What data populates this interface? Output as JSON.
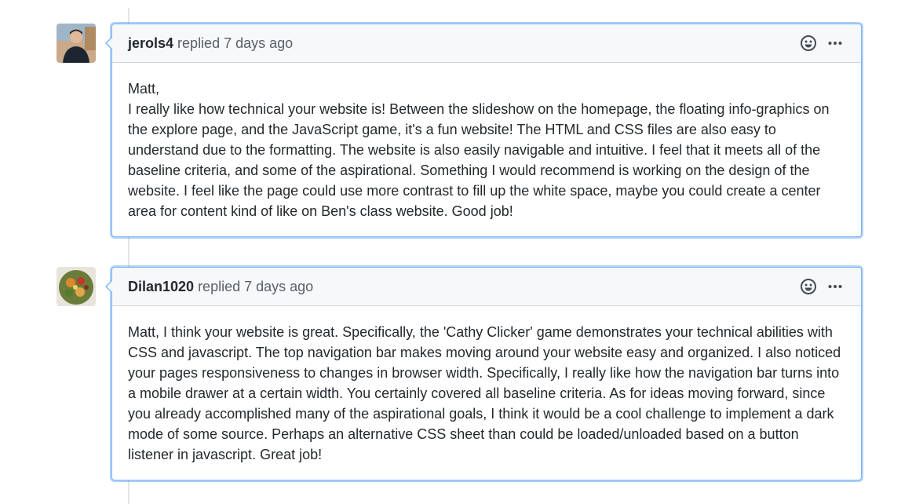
{
  "colors": {
    "accent_border": "#79b8ff",
    "header_bg": "#f6f8fa",
    "text": "#24292e",
    "muted": "#586069",
    "timeline": "#e1e4e8"
  },
  "comments": [
    {
      "author": "jerols4",
      "action": "replied",
      "timestamp": "7 days ago",
      "avatar_icon": "user-photo-avatar",
      "body": "Matt,\nI really like how technical your website is! Between the slideshow on the homepage, the floating info-graphics on the explore page, and the JavaScript game, it's a fun website! The HTML and CSS files are also easy to understand due to the formatting. The website is also easily navigable and intuitive. I feel that it meets all of the baseline criteria, and some of the aspirational. Something I would recommend is working on the design of the website. I feel like the page could use more contrast to fill up the white space, maybe you could create a center area for content kind of like on Ben's class website. Good job!"
    },
    {
      "author": "Dilan1020",
      "action": "replied",
      "timestamp": "7 days ago",
      "avatar_icon": "food-bowl-avatar",
      "body": "Matt, I think your website is great. Specifically, the 'Cathy Clicker' game demonstrates your technical abilities with CSS and javascript. The top navigation bar makes moving around your website easy and organized. I also noticed your pages responsiveness to changes in browser width. Specifically, I really like how the navigation bar turns into a mobile drawer at a certain width. You certainly covered all baseline criteria. As for ideas moving forward, since you already accomplished many of the aspirational goals, I think it would be a cool challenge to implement a dark mode of some source. Perhaps an alternative CSS sheet than could be loaded/unloaded based on a button listener in javascript. Great job!"
    }
  ],
  "icons": {
    "reaction": "smiley-icon",
    "more": "kebab-horizontal-icon"
  }
}
